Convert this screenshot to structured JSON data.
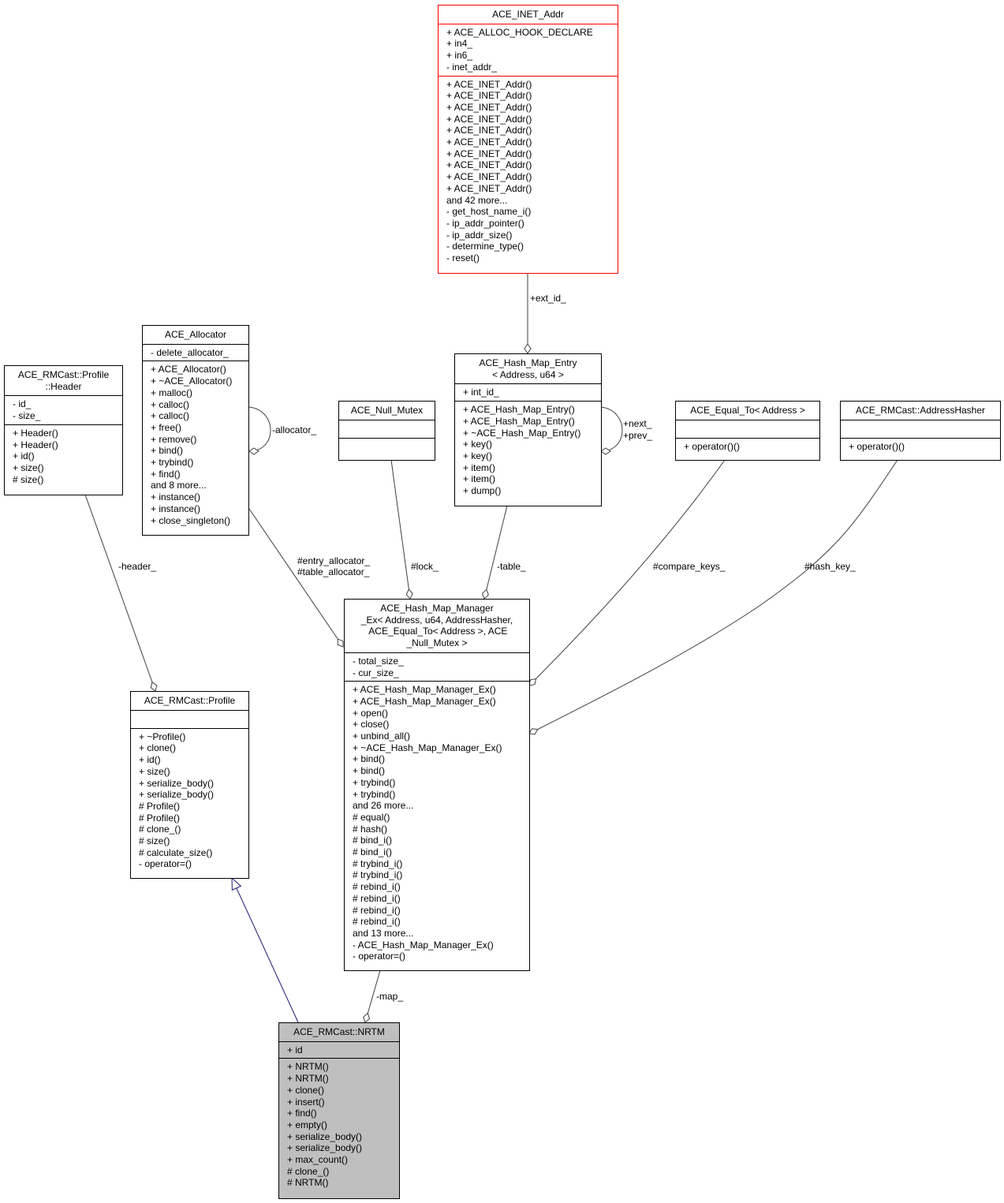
{
  "nodes": {
    "inet_addr": {
      "title": [
        "ACE_INET_Addr"
      ],
      "attributes": [
        "+ ACE_ALLOC_HOOK_DECLARE",
        "+ in4_",
        "+ in6_",
        "- inet_addr_"
      ],
      "methods": [
        "+ ACE_INET_Addr()",
        "+ ACE_INET_Addr()",
        "+ ACE_INET_Addr()",
        "+ ACE_INET_Addr()",
        "+ ACE_INET_Addr()",
        "+ ACE_INET_Addr()",
        "+ ACE_INET_Addr()",
        "+ ACE_INET_Addr()",
        "+ ACE_INET_Addr()",
        "+ ACE_INET_Addr()",
        "and 42 more...",
        "- get_host_name_i()",
        "- ip_addr_pointer()",
        "- ip_addr_size()",
        "- determine_type()",
        "- reset()"
      ]
    },
    "allocator": {
      "title": [
        "ACE_Allocator"
      ],
      "attributes": [
        "- delete_allocator_"
      ],
      "methods": [
        "+ ACE_Allocator()",
        "+ ~ACE_Allocator()",
        "+ malloc()",
        "+ calloc()",
        "+ calloc()",
        "+ free()",
        "+ remove()",
        "+ bind()",
        "+ trybind()",
        "+ find()",
        "and 8 more...",
        "+ instance()",
        "+ instance()",
        "+ close_singleton()"
      ]
    },
    "header": {
      "title": [
        "ACE_RMCast::Profile",
        "::Header"
      ],
      "attributes": [
        "- id_",
        "- size_"
      ],
      "methods": [
        "+ Header()",
        "+ Header()",
        "+ id()",
        "+ size()",
        "# size()"
      ]
    },
    "null_mutex": {
      "title": [
        "ACE_Null_Mutex"
      ],
      "attributes": [],
      "methods": []
    },
    "hash_entry": {
      "title": [
        "ACE_Hash_Map_Entry",
        "< Address, u64 >"
      ],
      "attributes": [
        "+ int_id_"
      ],
      "methods": [
        "+ ACE_Hash_Map_Entry()",
        "+ ACE_Hash_Map_Entry()",
        "+ ~ACE_Hash_Map_Entry()",
        "+ key()",
        "+ key()",
        "+ item()",
        "+ item()",
        "+ dump()"
      ]
    },
    "equal_to": {
      "title": [
        "ACE_Equal_To< Address >"
      ],
      "attributes": [],
      "methods": [
        "+ operator()()"
      ]
    },
    "hasher": {
      "title": [
        "ACE_RMCast::AddressHasher"
      ],
      "attributes": [],
      "methods": [
        "+ operator()()"
      ]
    },
    "profile": {
      "title": [
        "ACE_RMCast::Profile"
      ],
      "attributes": [],
      "methods": [
        "+ ~Profile()",
        "+ clone()",
        "+ id()",
        "+ size()",
        "+ serialize_body()",
        "+ serialize_body()",
        "# Profile()",
        "# Profile()",
        "# clone_()",
        "# size()",
        "# calculate_size()",
        "- operator=()"
      ]
    },
    "map_manager": {
      "title": [
        "ACE_Hash_Map_Manager",
        "_Ex< Address, u64, AddressHasher,",
        " ACE_Equal_To< Address >, ACE",
        "_Null_Mutex >"
      ],
      "attributes": [
        "- total_size_",
        "- cur_size_"
      ],
      "methods": [
        "+ ACE_Hash_Map_Manager_Ex()",
        "+ ACE_Hash_Map_Manager_Ex()",
        "+ open()",
        "+ close()",
        "+ unbind_all()",
        "+ ~ACE_Hash_Map_Manager_Ex()",
        "+ bind()",
        "+ bind()",
        "+ trybind()",
        "+ trybind()",
        "and 26 more...",
        "# equal()",
        "# hash()",
        "# bind_i()",
        "# bind_i()",
        "# trybind_i()",
        "# trybind_i()",
        "# rebind_i()",
        "# rebind_i()",
        "# rebind_i()",
        "# rebind_i()",
        "and 13 more...",
        "- ACE_Hash_Map_Manager_Ex()",
        "- operator=()"
      ]
    },
    "nrtm": {
      "title": [
        "ACE_RMCast::NRTM"
      ],
      "attributes": [
        "+ id"
      ],
      "methods": [
        "+ NRTM()",
        "+ NRTM()",
        "+ clone()",
        "+ insert()",
        "+ find()",
        "+ empty()",
        "+ serialize_body()",
        "+ serialize_body()",
        "+ max_count()",
        "# clone_()",
        "# NRTM()"
      ]
    }
  },
  "edge_labels": {
    "ext_id": "+ext_id_",
    "allocator_self": "-allocator_",
    "next_prev": [
      "+next_",
      "+prev_"
    ],
    "header": "-header_",
    "entry_table_allocator": [
      "#entry_allocator_",
      "#table_allocator_"
    ],
    "lock": "#lock_",
    "table": "-table_",
    "compare_keys": "#compare_keys_",
    "hash_key": "#hash_key_",
    "map": "-map_"
  },
  "colors": {
    "highlight_fill": "#bfbfbf",
    "external_border": "#ff0000",
    "inheritance_edge": "#191970",
    "association_edge": "#404040"
  }
}
